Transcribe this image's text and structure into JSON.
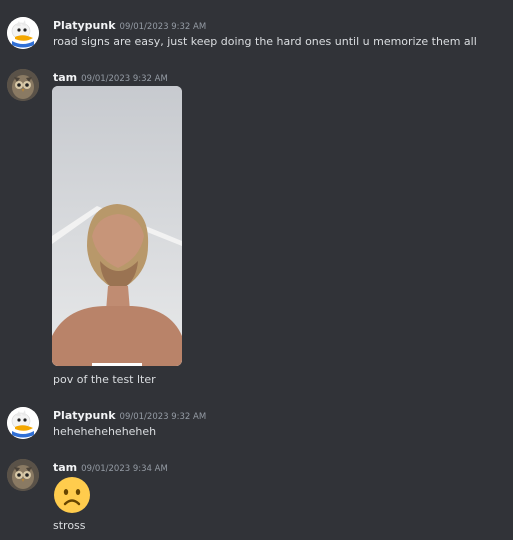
{
  "messages": [
    {
      "username": "Platypunk",
      "timestamp": "09/01/2023 9:32 AM",
      "text": "road signs are easy, just keep doing the hard ones until u memorize them all"
    },
    {
      "username": "tam",
      "timestamp": "09/01/2023 9:32 AM",
      "attachment_icon": "photo-attachment",
      "text": "pov of the test lter"
    },
    {
      "username": "Platypunk",
      "timestamp": "09/01/2023 9:32 AM",
      "text": "heheheheheheheh"
    },
    {
      "username": "tam",
      "timestamp": "09/01/2023 9:34 AM",
      "emoji": "frowning-face-emoji",
      "text": "stross"
    }
  ],
  "colors": {
    "background": "#313338",
    "username": "#f2f3f5",
    "timestamp": "#949ba4",
    "text": "#dbdee1",
    "emoji_yellow": "#ffcc4d"
  }
}
